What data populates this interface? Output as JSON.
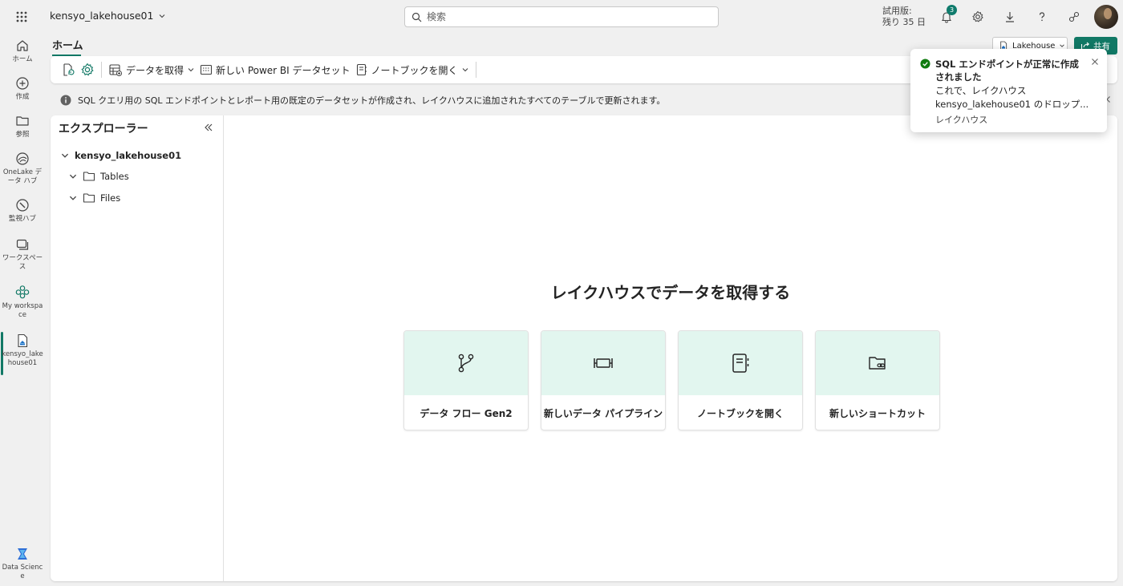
{
  "topbar": {
    "workspace_name": "kensyo_lakehouse01",
    "search_placeholder": "検索",
    "trial_line1": "試用版:",
    "trial_line2": "残り 35 日",
    "notification_count": "3"
  },
  "rail": {
    "items": [
      {
        "label": "ホーム"
      },
      {
        "label": "作成"
      },
      {
        "label": "参照"
      },
      {
        "label": "OneLake データ ハブ"
      },
      {
        "label": "監視ハブ"
      },
      {
        "label": "ワークスペース"
      },
      {
        "label": "My workspace"
      },
      {
        "label": "kensyo_lakehouse01"
      },
      {
        "label": "Data Science"
      }
    ]
  },
  "page": {
    "home_tab": "ホーム",
    "lakehouse_label": "Lakehouse",
    "share_label": "共有"
  },
  "ribbon": {
    "get_data": "データを取得",
    "new_dataset": "新しい Power BI データセット",
    "open_notebook": "ノートブックを開く"
  },
  "infobar": {
    "message": "SQL クエリ用の SQL エンドポイントとレポート用の既定のデータセットが作成され、レイクハウスに追加されたすべてのテーブルで更新されます。"
  },
  "explorer": {
    "title": "エクスプローラー",
    "root": "kensyo_lakehouse01",
    "folders": [
      "Tables",
      "Files"
    ]
  },
  "content": {
    "title": "レイクハウスでデータを取得する",
    "cards": [
      {
        "label": "データ フロー Gen2",
        "icon": "branch-icon"
      },
      {
        "label": "新しいデータ パイプライン",
        "icon": "pipeline-icon"
      },
      {
        "label": "ノートブックを開く",
        "icon": "notebook-icon"
      },
      {
        "label": "新しいショートカット",
        "icon": "folder-link-icon"
      }
    ]
  },
  "toast": {
    "title": "SQL エンドポイントが正常に作成されました",
    "body_line1": "これで、レイクハウス",
    "body_line2": "kensyo_lakehouse01 のドロップ...",
    "link": "レイクハウス"
  },
  "colors": {
    "accent": "#117865",
    "card_bg": "#e2f6ef",
    "success": "#107c10"
  }
}
